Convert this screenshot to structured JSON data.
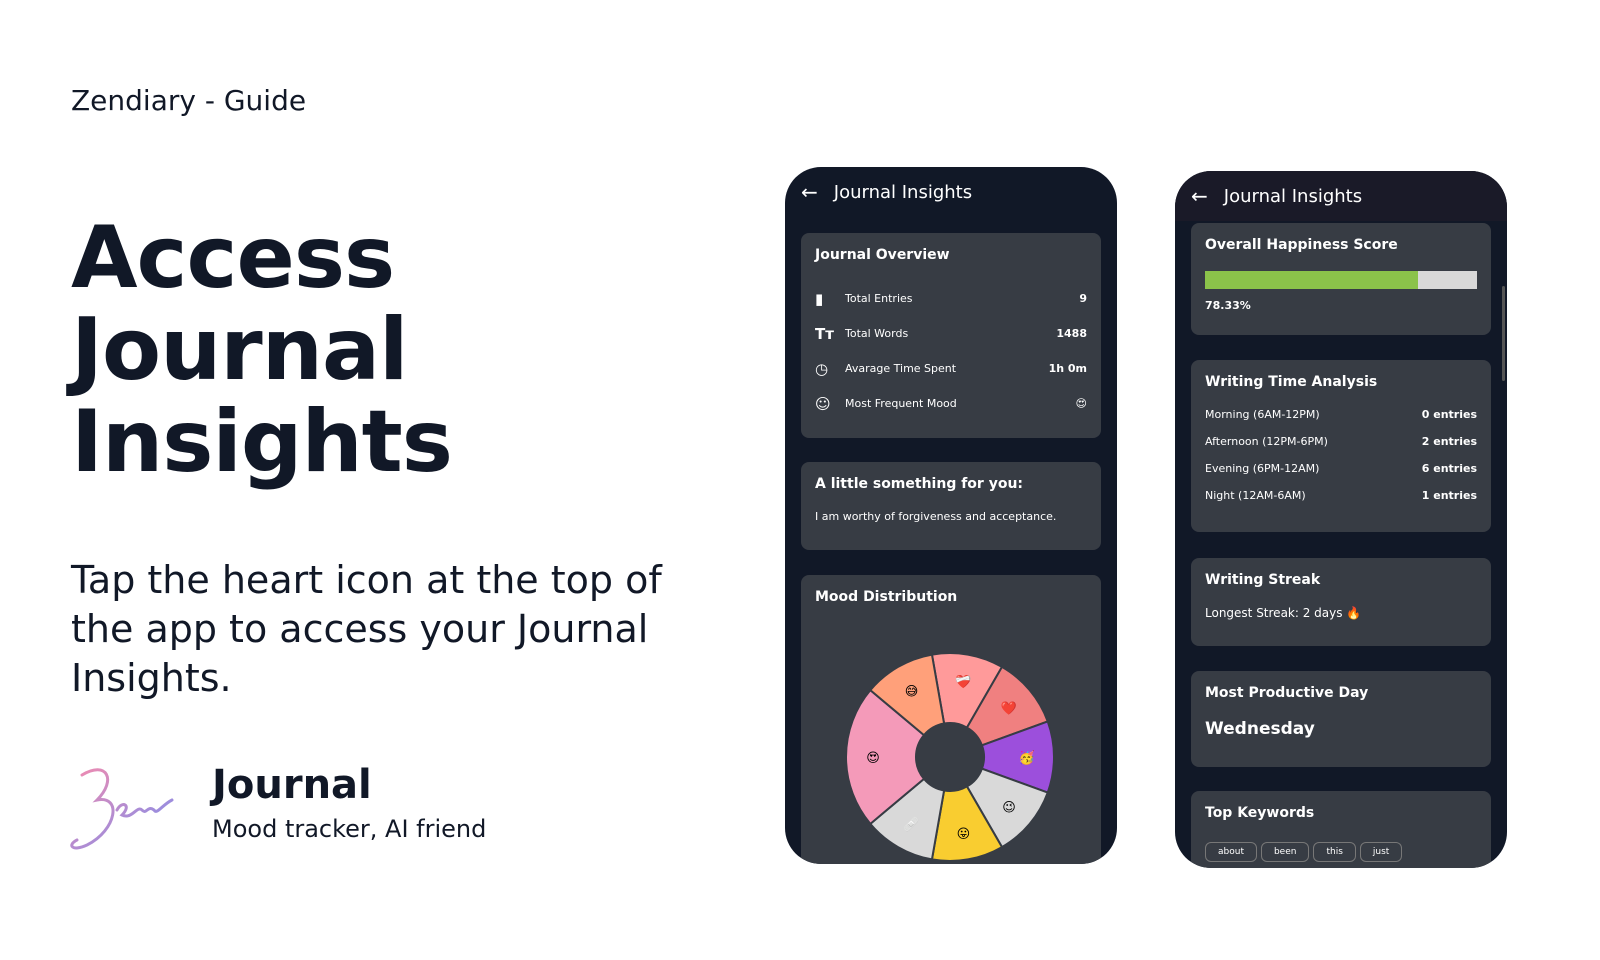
{
  "guide_title": "Zendiary - Guide",
  "headline": [
    "Access",
    "Journal",
    "Insights"
  ],
  "description": "Tap the heart icon at the top of the app to access your Journal Insights.",
  "brand": {
    "logo_text": "Zeni",
    "name": "Journal",
    "tagline": "Mood tracker, AI friend"
  },
  "phone1": {
    "title": "Journal Insights",
    "overview": {
      "title": "Journal Overview",
      "rows": [
        {
          "icon": "book-icon",
          "label": "Total Entries",
          "value": "9"
        },
        {
          "icon": "text-size-icon",
          "label": "Total Words",
          "value": "1488"
        },
        {
          "icon": "clock-icon",
          "label": "Avarage Time Spent",
          "value": "1h 0m"
        },
        {
          "icon": "smiley-icon",
          "label": "Most Frequent Mood",
          "value": "😍"
        }
      ]
    },
    "affirmation": {
      "title": "A little something for you:",
      "text": "I am worthy of forgiveness and acceptance."
    },
    "mood_title": "Mood Distribution",
    "chart_data": {
      "type": "pie",
      "donut": true,
      "slices": [
        {
          "emoji": "❤️‍🩹",
          "value": 1,
          "color": "#ff9a9a"
        },
        {
          "emoji": "❤️",
          "value": 1,
          "color": "#f08080"
        },
        {
          "emoji": "🥳",
          "value": 1,
          "color": "#9c4fdc"
        },
        {
          "emoji": "😉",
          "value": 1,
          "color": "#d9d9d9"
        },
        {
          "emoji": "😛",
          "value": 1,
          "color": "#f9cd30"
        },
        {
          "emoji": "🩹",
          "value": 1,
          "color": "#d9d9d9"
        },
        {
          "emoji": "😍",
          "value": 2,
          "color": "#f49ab9"
        },
        {
          "emoji": "😅",
          "value": 1,
          "color": "#ffa07a"
        }
      ]
    }
  },
  "phone2": {
    "title": "Journal Insights",
    "happiness": {
      "title": "Overall Happiness Score",
      "percent": 78.33,
      "label": "78.33%"
    },
    "writing_time": {
      "title": "Writing Time Analysis",
      "rows": [
        {
          "label": "Morning (6AM-12PM)",
          "value": "0 entries"
        },
        {
          "label": "Afternoon (12PM-6PM)",
          "value": "2 entries"
        },
        {
          "label": "Evening (6PM-12AM)",
          "value": "6 entries"
        },
        {
          "label": "Night (12AM-6AM)",
          "value": "1 entries"
        }
      ]
    },
    "streak": {
      "title": "Writing Streak",
      "text": "Longest Streak: 2 days 🔥"
    },
    "productive": {
      "title": "Most Productive Day",
      "value": "Wednesday"
    },
    "keywords": {
      "title": "Top Keywords",
      "items": [
        "about",
        "been",
        "this",
        "just"
      ]
    }
  }
}
